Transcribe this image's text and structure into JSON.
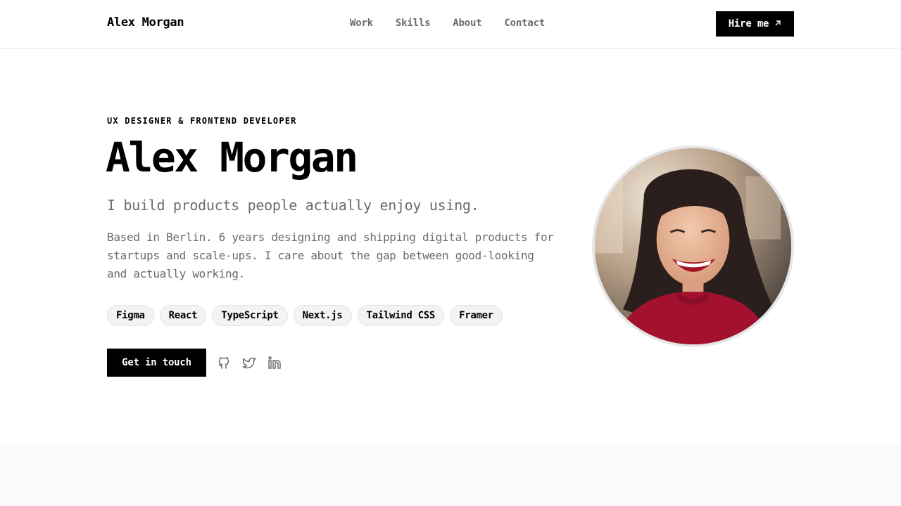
{
  "header": {
    "brand": "Alex Morgan",
    "nav": [
      "Work",
      "Skills",
      "About",
      "Contact"
    ],
    "hire_label": "Hire me"
  },
  "hero": {
    "eyebrow": "UX DESIGNER & FRONTEND DEVELOPER",
    "name": "Alex Morgan",
    "tagline": "I build products people actually enjoy using.",
    "bio": "Based in Berlin. 6 years designing and shipping digital products for startups and scale-ups. I care about the gap between good-looking and actually working.",
    "tags": [
      "Figma",
      "React",
      "TypeScript",
      "Next.js",
      "Tailwind CSS",
      "Framer"
    ],
    "cta_label": "Get in touch",
    "social": [
      "github-icon",
      "twitter-icon",
      "linkedin-icon"
    ]
  },
  "colors": {
    "accent": "#000000",
    "muted_text": "#6b6b6b",
    "tag_bg": "#f3f3f3",
    "band_bg": "#fafafa"
  }
}
